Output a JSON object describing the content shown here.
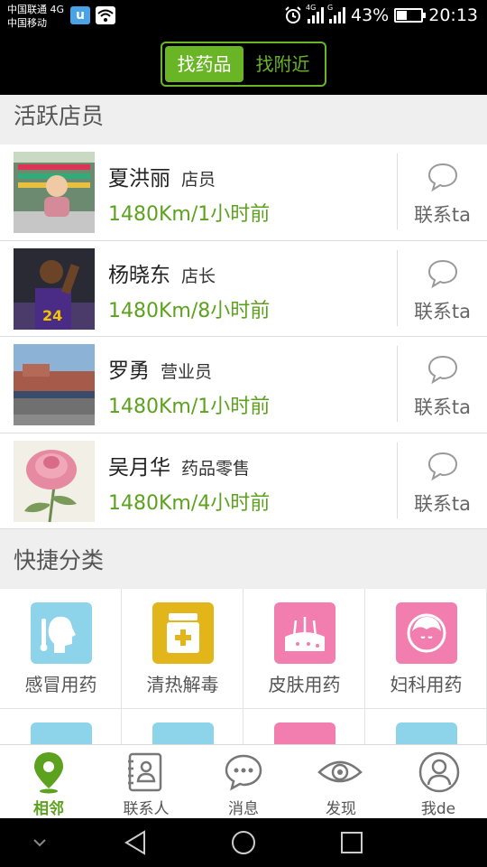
{
  "status_bar": {
    "carrier1": "中国联通 4G",
    "carrier2": "中国移动",
    "app_icon_letter": "u",
    "net_label_1": "4G",
    "net_label_2": "G",
    "battery_percent": "43%",
    "battery_level": 0.43,
    "time": "20:13"
  },
  "segment": {
    "options": [
      "找药品",
      "找附近"
    ],
    "active_index": 0,
    "accent_color": "#6ab526"
  },
  "staff_section": {
    "title": "活跃店员",
    "contact_label": "联系ta",
    "items": [
      {
        "name": "夏洪丽",
        "role": "店员",
        "distance": "1480Km/1小时前"
      },
      {
        "name": "杨晓东",
        "role": "店长",
        "distance": "1480Km/8小时前"
      },
      {
        "name": "罗勇",
        "role": "营业员",
        "distance": "1480Km/1小时前"
      },
      {
        "name": "吴月华",
        "role": "药品零售",
        "distance": "1480Km/4小时前"
      }
    ]
  },
  "category_section": {
    "title": "快捷分类",
    "items": [
      {
        "label": "感冒用药",
        "icon": "cold-medicine-icon",
        "color": "#8dd3ea"
      },
      {
        "label": "清热解毒",
        "icon": "medicine-box-icon",
        "color": "#e2b51a"
      },
      {
        "label": "皮肤用药",
        "icon": "skin-icon",
        "color": "#f27eb0"
      },
      {
        "label": "妇科用药",
        "icon": "gynecology-icon",
        "color": "#f27eb0"
      }
    ],
    "next_row_colors": [
      "#8dd3ea",
      "#8dd3ea",
      "#f27eb0",
      "#8dd3ea"
    ]
  },
  "tabs": [
    {
      "label": "相邻",
      "icon": "location-pin-icon",
      "active": true
    },
    {
      "label": "联系人",
      "icon": "contacts-icon",
      "active": false
    },
    {
      "label": "消息",
      "icon": "message-icon",
      "active": false
    },
    {
      "label": "发现",
      "icon": "eye-icon",
      "active": false
    },
    {
      "label": "我de",
      "icon": "profile-icon",
      "active": false
    }
  ]
}
